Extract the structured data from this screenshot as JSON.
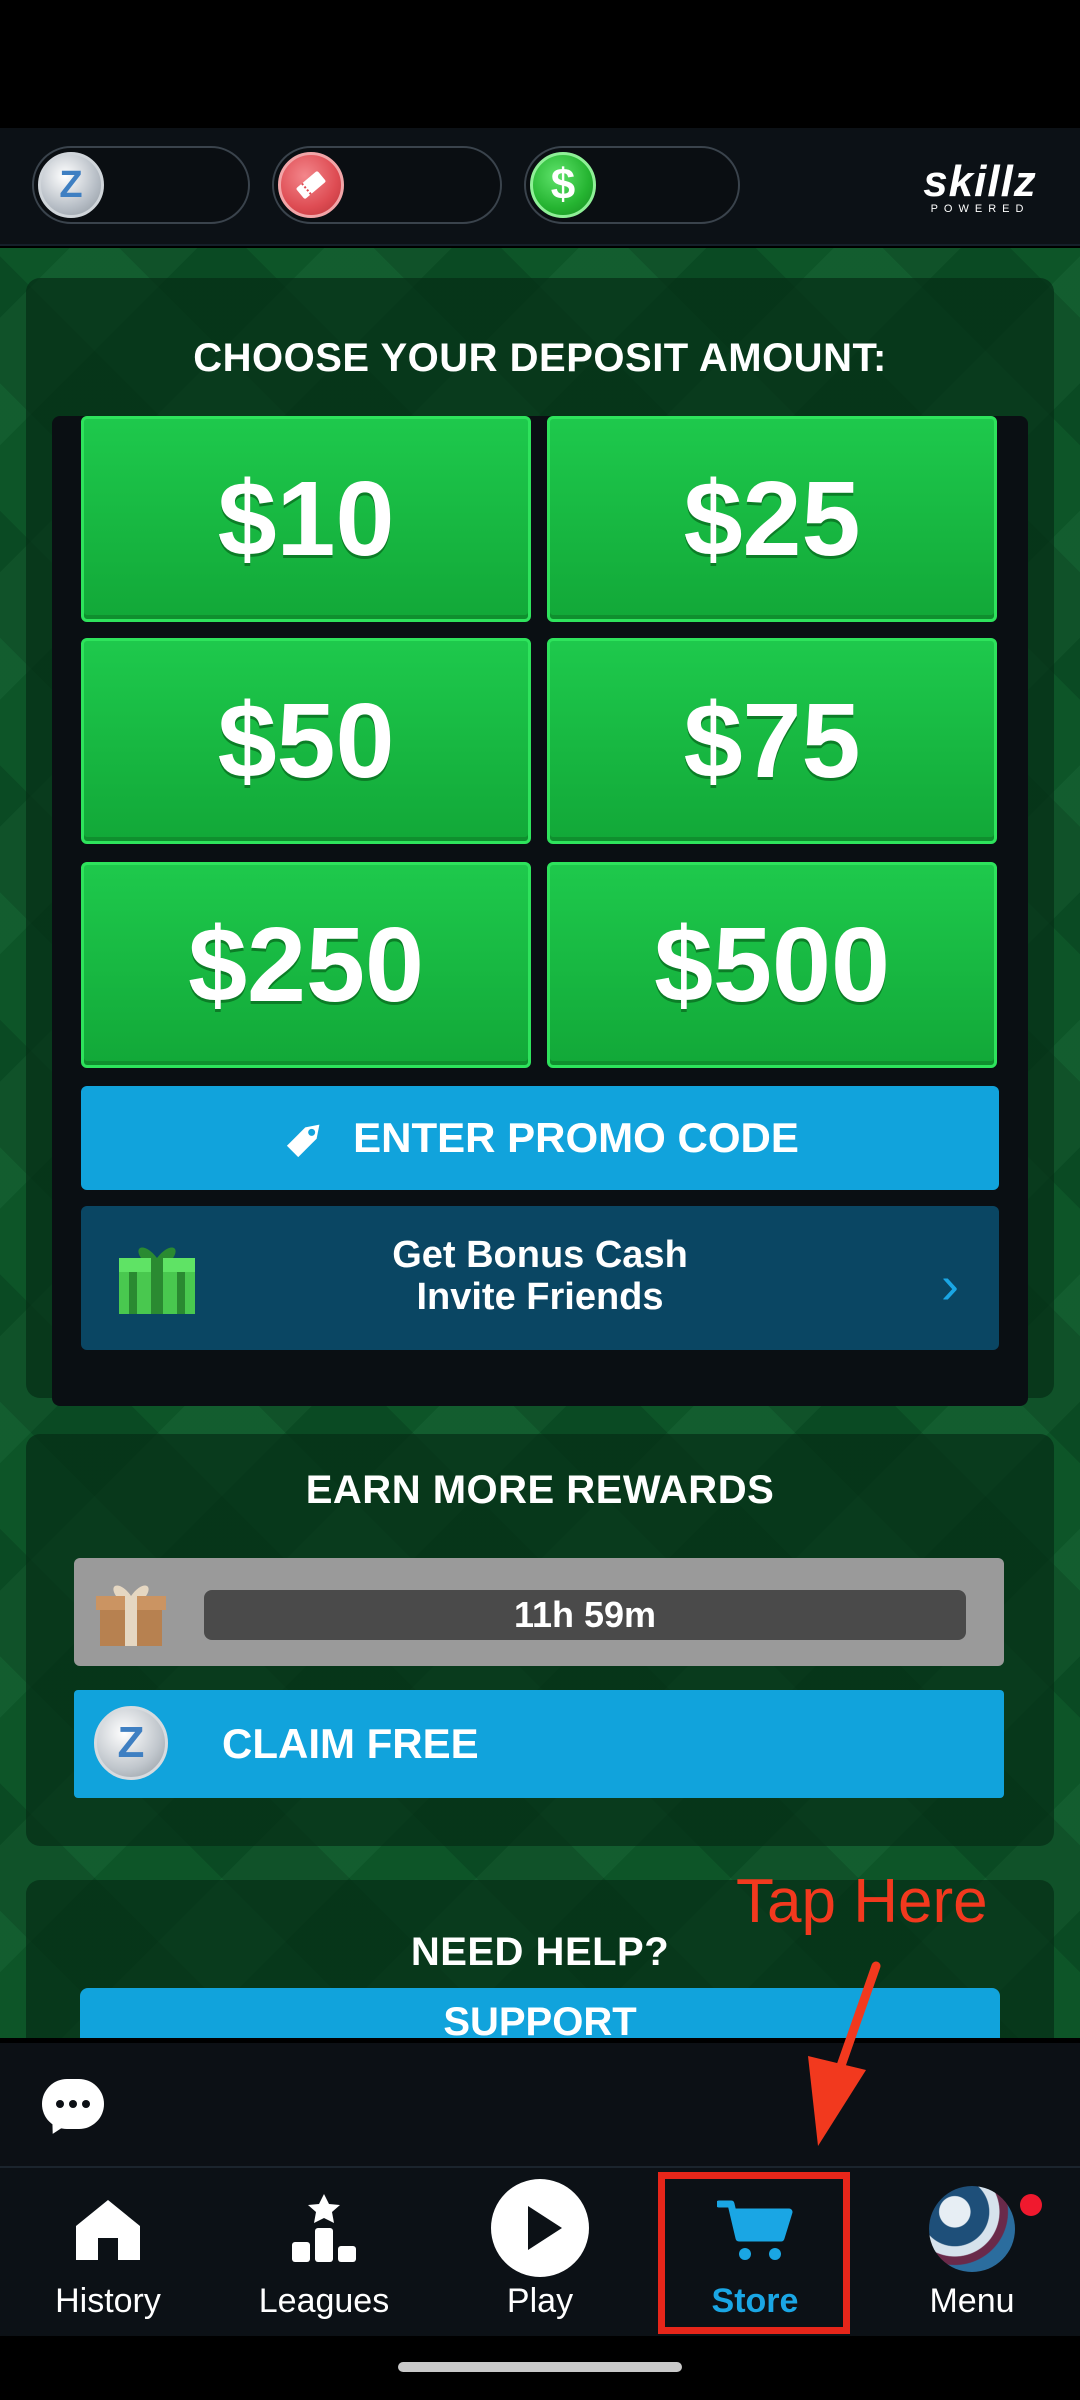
{
  "header": {
    "brand_name": "skillz",
    "brand_sub": "POWERED"
  },
  "deposit": {
    "title": "CHOOSE YOUR DEPOSIT AMOUNT:",
    "amounts": [
      "$10",
      "$25",
      "$50",
      "$75",
      "$250",
      "$500"
    ],
    "promo_label": "ENTER PROMO CODE",
    "bonus_line1": "Get Bonus Cash",
    "bonus_line2": "Invite Friends"
  },
  "rewards": {
    "title": "EARN MORE REWARDS",
    "timer": "11h 59m",
    "claim_label": "CLAIM FREE"
  },
  "help": {
    "title": "NEED HELP?",
    "support_label": "SUPPORT"
  },
  "annotation": {
    "text": "Tap Here",
    "color": "#f2391e"
  },
  "nav": {
    "items": [
      {
        "label": "History",
        "icon": "home-icon"
      },
      {
        "label": "Leagues",
        "icon": "leagues-icon"
      },
      {
        "label": "Play",
        "icon": "play-icon"
      },
      {
        "label": "Store",
        "icon": "cart-icon"
      },
      {
        "label": "Menu",
        "icon": "avatar"
      }
    ],
    "active": "Store",
    "active_color": "#1aa6e4"
  },
  "colors": {
    "accent_green": "#1ec94c",
    "accent_blue": "#11a3dc"
  }
}
